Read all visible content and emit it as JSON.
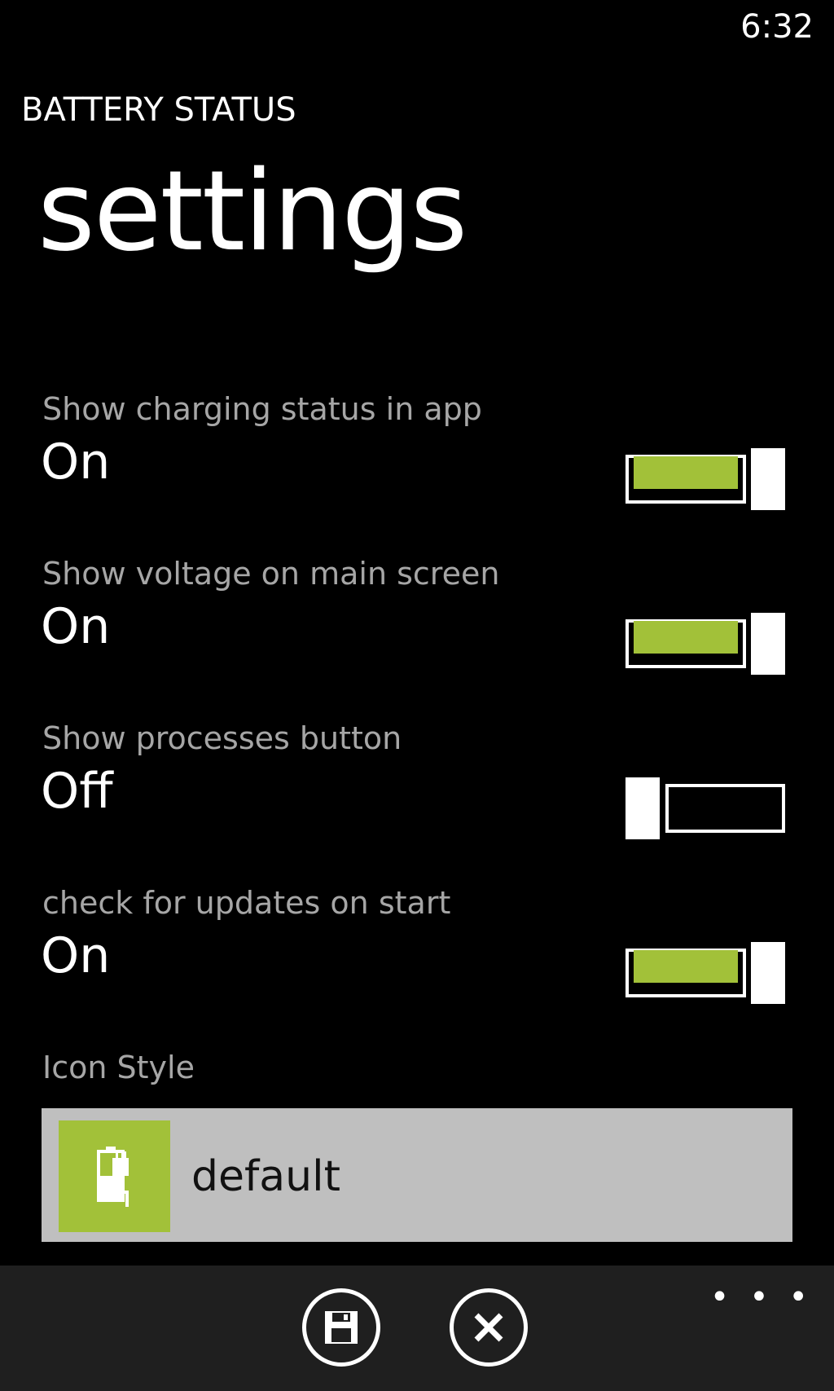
{
  "status_bar": {
    "time": "6:32"
  },
  "header": {
    "app_title": "BATTERY STATUS",
    "page_title": "settings"
  },
  "settings": [
    {
      "label": "",
      "value": "On",
      "state": "on"
    },
    {
      "label": "Show charging status in app",
      "value": "On",
      "state": "on"
    },
    {
      "label": "Show voltage on main screen",
      "value": "On",
      "state": "on"
    },
    {
      "label": "Show processes button",
      "value": "Off",
      "state": "off"
    },
    {
      "label": "check for updates on start",
      "value": "On",
      "state": "on"
    }
  ],
  "icon_style": {
    "label": "Icon Style",
    "value": "default",
    "icon": "battery-plug-icon",
    "accent": "#a2c139"
  },
  "app_bar": {
    "buttons": [
      {
        "icon": "save-icon"
      },
      {
        "icon": "close-icon"
      }
    ],
    "more": "• • •"
  },
  "colors": {
    "accent": "#a2c139",
    "background": "#000000",
    "appbar": "#1f1f1f"
  }
}
